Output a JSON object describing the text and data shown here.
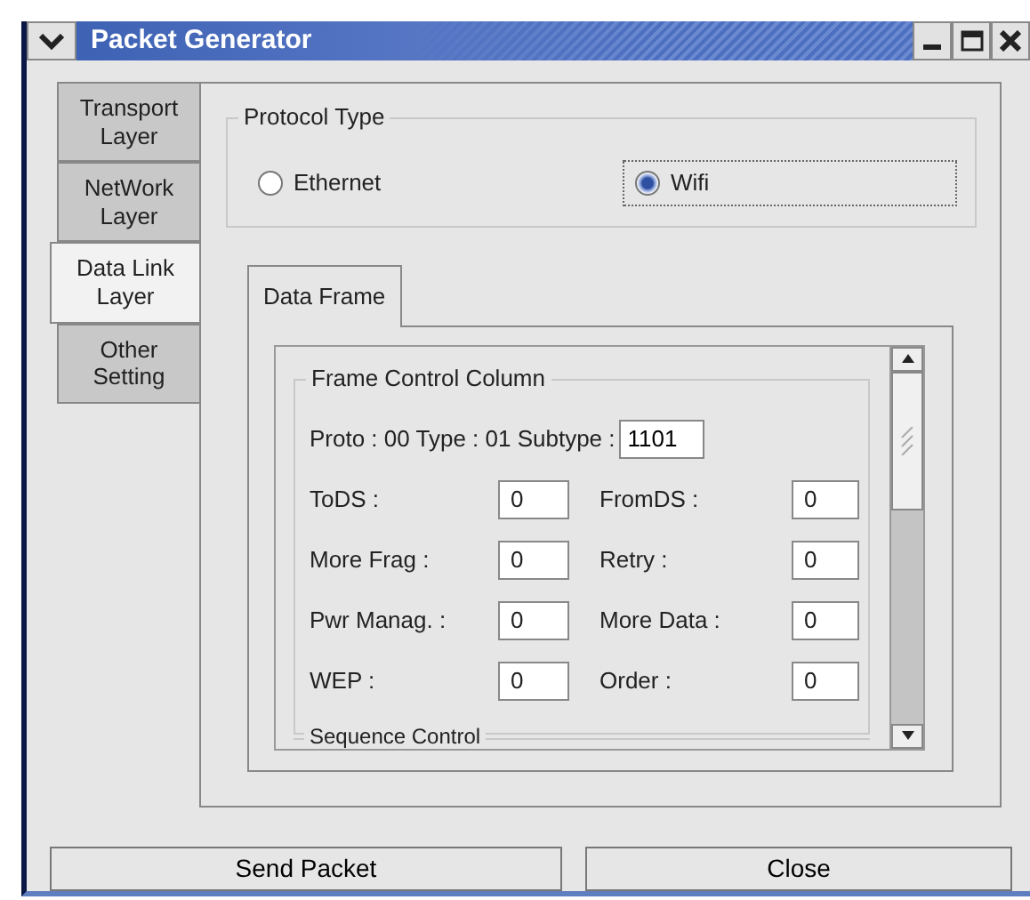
{
  "window": {
    "title": "Packet Generator"
  },
  "layer_tabs": [
    {
      "label": "Transport Layer",
      "selected": false
    },
    {
      "label": "NetWork Layer",
      "selected": false
    },
    {
      "label": "Data Link Layer",
      "selected": true
    },
    {
      "label": "Other Setting",
      "selected": false
    }
  ],
  "protocol_type": {
    "legend": "Protocol Type",
    "options": [
      {
        "label": "Ethernet",
        "selected": false,
        "focused": false
      },
      {
        "label": "Wifi",
        "selected": true,
        "focused": true
      }
    ]
  },
  "frame_tabs": [
    {
      "label": "Data Frame",
      "selected": true
    }
  ],
  "frame_control": {
    "legend": "Frame Control Column",
    "proto_label": "Proto : 00 Type : 01 Subtype :",
    "subtype_value": "1101",
    "fields": [
      {
        "label": "ToDS :",
        "value": "0"
      },
      {
        "label": "FromDS :",
        "value": "0"
      },
      {
        "label": "More Frag :",
        "value": "0"
      },
      {
        "label": "Retry :",
        "value": "0"
      },
      {
        "label": "Pwr Manag. :",
        "value": "0"
      },
      {
        "label": "More Data :",
        "value": "0"
      },
      {
        "label": "WEP :",
        "value": "0"
      },
      {
        "label": "Order :",
        "value": "0"
      }
    ]
  },
  "next_section": {
    "legend": "Sequence Control"
  },
  "buttons": [
    "Send Packet",
    "Close"
  ]
}
